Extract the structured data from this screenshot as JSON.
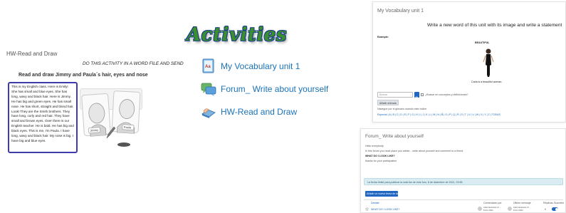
{
  "title": "Activities",
  "left": {
    "header": "HW-Read and Draw",
    "instruction": "DO THIS ACTIVITY IN A WORD FILE AND SEND",
    "task": "Read and draw Jimmy and Paula´s hair, eyes and nose",
    "story": "This is my English class. Here is Emily! She has small and blue eyes. She has long, wavy and black hair. Here is Jimmy. He has big and green eyes. He has small nose. He has short, straight and blond hair. Look! They are the Smith brothers. They have long, curly and red hair. They have small and brown eyes. Over there is our English teacher. He is bald. He has big and black eyes. This is me, I'm Paula. I have long, wavy and black hair. My nose is big. I have big and blue eyes.",
    "card_labels": [
      "Jimmy",
      "Paula"
    ]
  },
  "activities": [
    {
      "label": "My Vocabulary unit 1",
      "icon": "glossary-icon"
    },
    {
      "label": "Forum_ Write about yourself",
      "icon": "forum-icon"
    },
    {
      "label": "HW-Read and Draw",
      "icon": "assignment-icon"
    }
  ],
  "vocab_page": {
    "title": "My Vocabulary unit 1",
    "prompt": "Write a new word of this unit with its image and write a statement",
    "example_label": "Example:",
    "word": "BEAUTIFUL",
    "sentence": "Carla is a beautiful woman.",
    "search_placeholder": "Buscar",
    "search_option": "¿Buscar en conceptos y definiciones?",
    "add_button": "Añadir entrada",
    "browse_text": "Navegue por el glosario usando este índice",
    "alpha_index": "Especial | A | B | C | D | E | F | G | H | I | J | K | L | M | N | Ñ | O | P | Q | R | S | T | U | V | W | X | Y | Z | TODAS"
  },
  "forum_page": {
    "title": "Forum_ Write about yourself",
    "lines": [
      "Hello everybody",
      "In this forum you must place you article... write about yourself and comment to a friend",
      "WHAT DO I LOOK LIKE?",
      "thanks for your participation"
    ],
    "notice": "La fecha límite para publicar la nota fue de este foro, 8 de diciembre de 2021, 23:55",
    "new_topic_button": "Añadir un nuevo tema de debate",
    "table_headers": [
      "Debate",
      "Comenzado por",
      "Último mensaje",
      "Réplicas",
      "Suscribir"
    ],
    "row": {
      "topic": "WHAT DO I LOOK LIKE?",
      "started_by": "Administrador Fr...",
      "started_date": "8 dic 2021",
      "last_by": "Administrador Fr...",
      "last_date": "8 dic 2021",
      "replies": "0"
    }
  }
}
